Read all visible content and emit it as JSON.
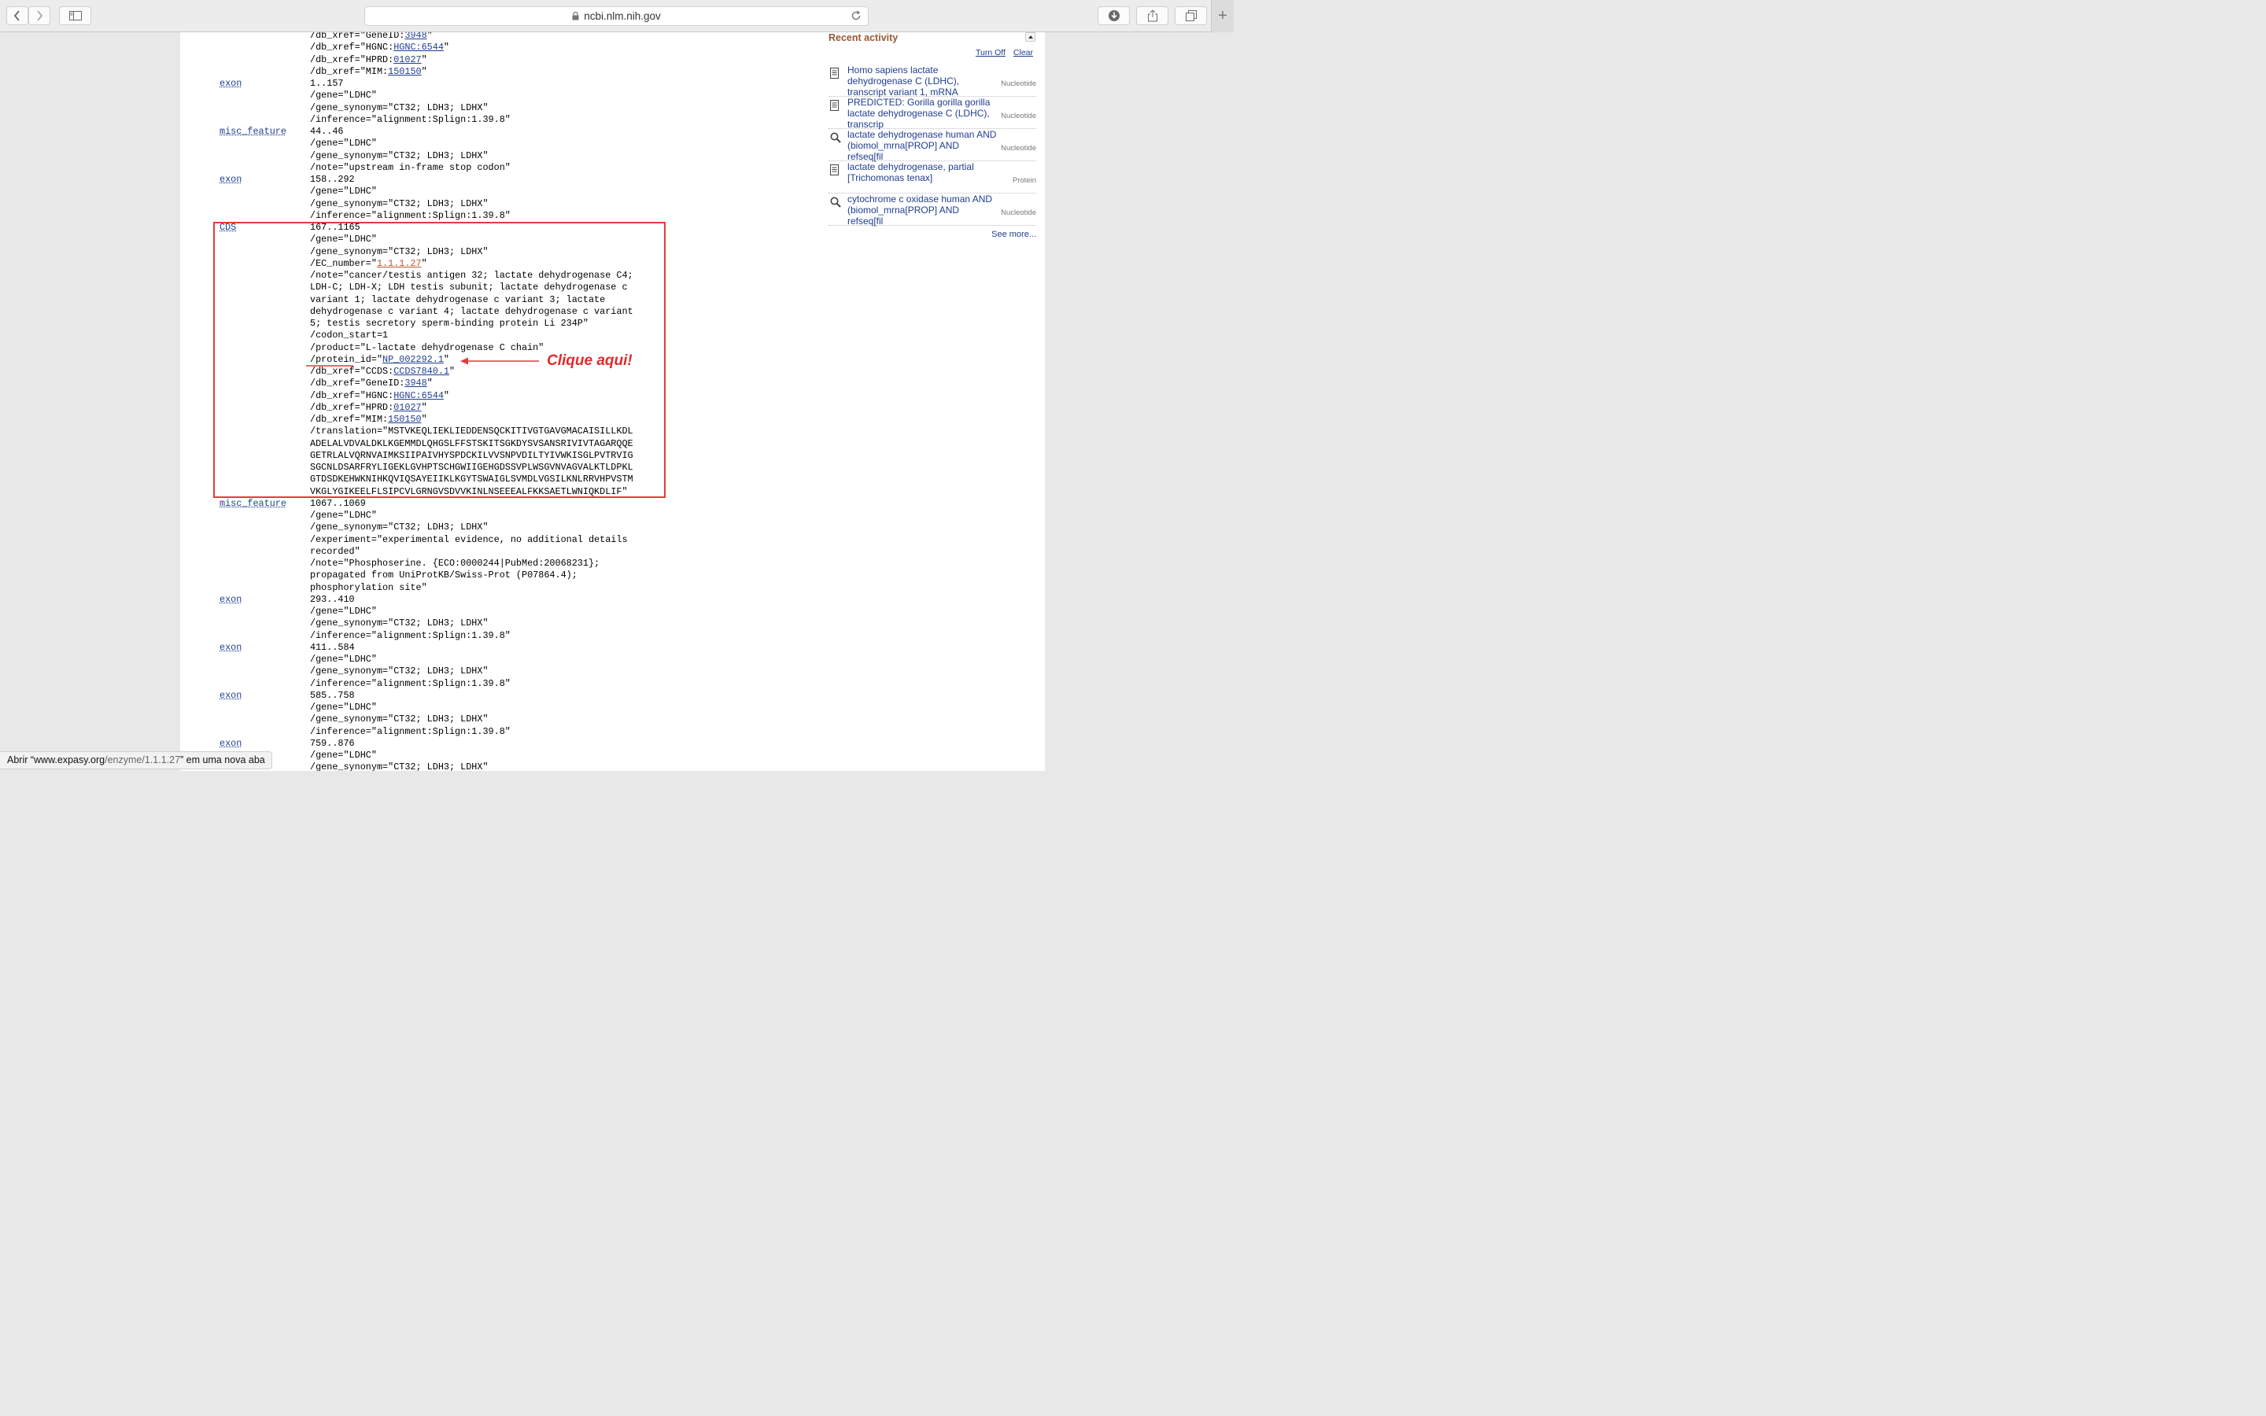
{
  "browser": {
    "url": "ncbi.nlm.nih.gov",
    "status_prefix": "Abrir “",
    "status_host": "www.expasy.org",
    "status_path": "/enzyme/1.1.1.27",
    "status_suffix": "” em uma nova aba"
  },
  "lines": [
    {
      "k": "qual",
      "t": "/db_xref=\"GeneID:",
      "l": "3948",
      "e": "\""
    },
    {
      "k": "qual",
      "t": "/db_xref=\"HGNC:",
      "l": "HGNC:6544",
      "e": "\""
    },
    {
      "k": "qual",
      "t": "/db_xref=\"HPRD:",
      "l": "01027",
      "e": "\""
    },
    {
      "k": "qual",
      "t": "/db_xref=\"MIM:",
      "l": "150150",
      "e": "\""
    },
    {
      "k": "feat",
      "f": "exon",
      "t": "1..157"
    },
    {
      "k": "qual",
      "t": "/gene=\"LDHC\""
    },
    {
      "k": "qual",
      "t": "/gene_synonym=\"CT32; LDH3; LDHX\""
    },
    {
      "k": "qual",
      "t": "/inference=\"alignment:Splign:1.39.8\""
    },
    {
      "k": "feat",
      "f": "misc_feature",
      "t": "44..46"
    },
    {
      "k": "qual",
      "t": "/gene=\"LDHC\""
    },
    {
      "k": "qual",
      "t": "/gene_synonym=\"CT32; LDH3; LDHX\""
    },
    {
      "k": "qual",
      "t": "/note=\"upstream in-frame stop codon\""
    },
    {
      "k": "feat",
      "f": "exon",
      "t": "158..292"
    },
    {
      "k": "qual",
      "t": "/gene=\"LDHC\""
    },
    {
      "k": "qual",
      "t": "/gene_synonym=\"CT32; LDH3; LDHX\""
    },
    {
      "k": "qual",
      "t": "/inference=\"alignment:Splign:1.39.8\""
    },
    {
      "k": "feat",
      "f": "CDS",
      "t": "167..1165"
    },
    {
      "k": "qual",
      "t": "/gene=\"LDHC\""
    },
    {
      "k": "qual",
      "t": "/gene_synonym=\"CT32; LDH3; LDHX\""
    },
    {
      "k": "qual",
      "t": "/EC_number=\"",
      "l": "1.1.1.27",
      "e": "\"",
      "ec": true
    },
    {
      "k": "qual",
      "t": "/note=\"cancer/testis antigen 32; lactate dehydrogenase C4;"
    },
    {
      "k": "qual",
      "t": "LDH-C; LDH-X; LDH testis subunit; lactate dehydrogenase c"
    },
    {
      "k": "qual",
      "t": "variant 1; lactate dehydrogenase c variant 3; lactate"
    },
    {
      "k": "qual",
      "t": "dehydrogenase c variant 4; lactate dehydrogenase c variant"
    },
    {
      "k": "qual",
      "t": "5; testis secretory sperm-binding protein Li 234P\""
    },
    {
      "k": "qual",
      "t": "/codon_start=1"
    },
    {
      "k": "qual",
      "t": "/product=\"L-lactate dehydrogenase C chain\""
    },
    {
      "k": "qual",
      "t": "/protein_id=\"",
      "l": "NP_002292.1",
      "e": "\""
    },
    {
      "k": "qual",
      "t": "/db_xref=\"CCDS:",
      "l": "CCDS7840.1",
      "e": "\""
    },
    {
      "k": "qual",
      "t": "/db_xref=\"GeneID:",
      "l": "3948",
      "e": "\""
    },
    {
      "k": "qual",
      "t": "/db_xref=\"HGNC:",
      "l": "HGNC:6544",
      "e": "\""
    },
    {
      "k": "qual",
      "t": "/db_xref=\"HPRD:",
      "l": "01027",
      "e": "\""
    },
    {
      "k": "qual",
      "t": "/db_xref=\"MIM:",
      "l": "150150",
      "e": "\""
    },
    {
      "k": "qual",
      "t": "/translation=\"MSTVKEQLIEKLIEDDENSQCKITIVGTGAVGMACAISILLKDL"
    },
    {
      "k": "qual",
      "t": "ADELALVDVALDKLKGEMMDLQHGSLFFSTSKITSGKDYSVSANSRIVIVTAGARQQE"
    },
    {
      "k": "qual",
      "t": "GETRLALVQRNVAIMKSIIPAIVHYSPDCKILVVSNPVDILTYIVWKISGLPVTRVIG"
    },
    {
      "k": "qual",
      "t": "SGCNLDSARFRYLIGEKLGVHPTSCHGWIIGEHGDSSVPLWSGVNVAGVALKTLDPKL"
    },
    {
      "k": "qual",
      "t": "GTDSDKEHWKNIHKQVIQSAYEIIKLKGYTSWAIGLSVMDLVGSILKNLRRVHPVSTM"
    },
    {
      "k": "qual",
      "t": "VKGLYGIKEELFLSIPCVLGRNGVSDVVKINLNSEEEALFKKSAETLWNIQKDLIF\""
    },
    {
      "k": "feat",
      "f": "misc_feature",
      "t": "1067..1069"
    },
    {
      "k": "qual",
      "t": "/gene=\"LDHC\""
    },
    {
      "k": "qual",
      "t": "/gene_synonym=\"CT32; LDH3; LDHX\""
    },
    {
      "k": "qual",
      "t": "/experiment=\"experimental evidence, no additional details"
    },
    {
      "k": "qual",
      "t": "recorded\""
    },
    {
      "k": "qual",
      "t": "/note=\"Phosphoserine. {ECO:0000244|PubMed:20068231};"
    },
    {
      "k": "qual",
      "t": "propagated from UniProtKB/Swiss-Prot (P07864.4);"
    },
    {
      "k": "qual",
      "t": "phosphorylation site\""
    },
    {
      "k": "feat",
      "f": "exon",
      "t": "293..410"
    },
    {
      "k": "qual",
      "t": "/gene=\"LDHC\""
    },
    {
      "k": "qual",
      "t": "/gene_synonym=\"CT32; LDH3; LDHX\""
    },
    {
      "k": "qual",
      "t": "/inference=\"alignment:Splign:1.39.8\""
    },
    {
      "k": "feat",
      "f": "exon",
      "t": "411..584"
    },
    {
      "k": "qual",
      "t": "/gene=\"LDHC\""
    },
    {
      "k": "qual",
      "t": "/gene_synonym=\"CT32; LDH3; LDHX\""
    },
    {
      "k": "qual",
      "t": "/inference=\"alignment:Splign:1.39.8\""
    },
    {
      "k": "feat",
      "f": "exon",
      "t": "585..758"
    },
    {
      "k": "qual",
      "t": "/gene=\"LDHC\""
    },
    {
      "k": "qual",
      "t": "/gene_synonym=\"CT32; LDH3; LDHX\""
    },
    {
      "k": "qual",
      "t": "/inference=\"alignment:Splign:1.39.8\""
    },
    {
      "k": "feat",
      "f": "exon",
      "t": "759..876"
    },
    {
      "k": "qual",
      "t": "/gene=\"LDHC\""
    },
    {
      "k": "qual",
      "t": "/gene_synonym=\"CT32; LDH3; LDHX\""
    }
  ],
  "annotation": "Clique aqui!",
  "sidebar": {
    "title": "Recent activity",
    "turn_off": "Turn Off",
    "clear": "Clear",
    "items": [
      {
        "icon": "document-icon",
        "text": "Homo sapiens lactate dehydrogenase C (LDHC), transcript variant 1, mRNA",
        "db": "Nucleotide"
      },
      {
        "icon": "document-icon",
        "text": "PREDICTED: Gorilla gorilla gorilla lactate dehydrogenase C (LDHC), transcrip",
        "db": "Nucleotide"
      },
      {
        "icon": "search-icon",
        "text": "lactate dehydrogenase human AND (biomol_mrna[PROP] AND refseq[fil",
        "db": "Nucleotide"
      },
      {
        "icon": "document-icon",
        "text": "lactate dehydrogenase, partial [Trichomonas tenax]",
        "db": "Protein"
      },
      {
        "icon": "search-icon",
        "text": "cytochrome c oxidase human AND (biomol_mrna[PROP] AND refseq[fil",
        "db": "Nucleotide"
      }
    ],
    "see_more": "See more..."
  }
}
